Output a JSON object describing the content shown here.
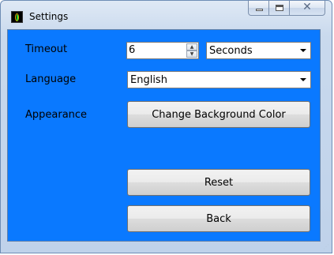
{
  "window": {
    "title": "Settings",
    "icons": {
      "app": "app-icon",
      "minimize": "minimize-icon",
      "maximize": "maximize-icon",
      "close": "close-icon",
      "close_glyph": "✕"
    }
  },
  "colors": {
    "client_background": "#0a79ff",
    "titlebar": "#c9d9ed"
  },
  "form": {
    "timeout": {
      "label": "Timeout",
      "value": "6",
      "unit_selected": "Seconds"
    },
    "language": {
      "label": "Language",
      "selected": "English"
    },
    "appearance": {
      "label": "Appearance",
      "button_label": "Change Background Color"
    }
  },
  "actions": {
    "reset_label": "Reset",
    "back_label": "Back"
  }
}
